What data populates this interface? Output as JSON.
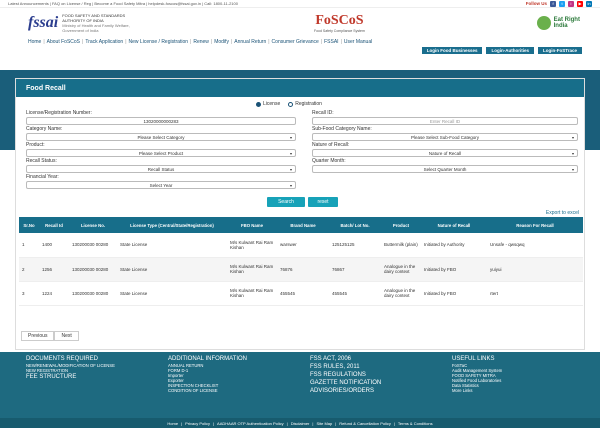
{
  "topbar": {
    "links": "Latest Announcements | FAQ on License / Reg | Become a Food Safety Mitra | helpdesk-foscos@fssai.gov.in | Call: 1800-11-2100",
    "follow_label": "Follow Us"
  },
  "header": {
    "fssai": "fssai",
    "authority": "FOOD SAFETY AND STANDARDS AUTHORITY OF INDIA",
    "ministry": "Ministry of Health and Family Welfare, Government of India",
    "app_name": "FoSCoS",
    "app_sub": "Food Safety Compliance System",
    "eatright1": "Eat Right",
    "eatright2": "India"
  },
  "nav": {
    "items": [
      "Home",
      "About FoSCoS",
      "Track Application",
      "New License / Registration",
      "Renew",
      "Modify",
      "Annual Return",
      "Consumer Grievance",
      "FSSAI",
      "User Manual"
    ],
    "sub": [
      "Login Food Businesses",
      "Login-Authorities",
      "Login-FoSTrace"
    ]
  },
  "form": {
    "title": "Food Recall",
    "radio_license": "License",
    "radio_registration": "Registration",
    "lic_label": "License/Registration Number:",
    "lic_value": "13020000000283",
    "recall_id_label": "Recall ID:",
    "recall_id_placeholder": "Enter Recall ID",
    "category_label": "Category Name:",
    "category_value": "Please Select Category",
    "subcategory_label": "Sub-Food Category Name:",
    "subcategory_value": "Please Select Sub-Food Category",
    "product_label": "Product:",
    "product_value": "Please Select Product",
    "nature_label": "Nature of Recall:",
    "nature_value": "Nature of Recall",
    "status_label": "Recall Status:",
    "status_value": "Recall Status",
    "quarter_label": "Quarter Month:",
    "quarter_value": "Select Quarter Month",
    "year_label": "Financial Year:",
    "year_value": "Select Year",
    "search_btn": "Search",
    "reset_btn": "reset",
    "export": "Export to excel"
  },
  "table": {
    "headers": [
      "Sr.No",
      "Recall Id",
      "License No.",
      "License Type (Central/State/Registration)",
      "FBO Name",
      "Brand Name",
      "Batch/ Lot No.",
      "Product",
      "Nature of Recall",
      "Reason For Recall"
    ],
    "rows": [
      [
        "1",
        "1400",
        "130200030 00280",
        "State License",
        "M/s Kulwant Rai Ram Kishan",
        "warswer",
        "125125125",
        "Buttermilk (plain)",
        "Initiated by Authority",
        "Unsafe - qwsqwq"
      ],
      [
        "2",
        "1256",
        "130200030 00280",
        "State License",
        "M/s Kulwant Rai Ram Kishan",
        "76876",
        "76867",
        "Analogue in the dairy context",
        "Initiated by FBO",
        "yuiyui"
      ],
      [
        "3",
        "1224",
        "130200030 00280",
        "State License",
        "M/s Kulwant Rai Ram Kishan",
        "455545",
        "455545",
        "Analogue in the dairy context",
        "Initiated by FBO",
        "rtert"
      ]
    ]
  },
  "pager": {
    "prev": "Previous",
    "next": "Next"
  },
  "footer": {
    "col1": {
      "h1": "DOCUMENTS REQUIRED",
      "a": "NEW/RENEWAL/MODIFICATION OF LICENSE",
      "b": "NEW REGISTRATION",
      "h2": "FEE STRUCTURE"
    },
    "col2": {
      "h": "ADDITIONAL INFORMATION",
      "items": [
        "ANNUAL RETURN",
        "FORM D-1",
        "Importer",
        "Exporter",
        "INSPECTION CHECKLIST",
        "CONDITION OF LICENSE"
      ]
    },
    "col3": {
      "items": [
        "FSS ACT, 2006",
        "FSS RULES, 2011",
        "FSS REGULATIONS",
        "GAZETTE NOTIFICATION",
        "ADVISORIES/ORDERS"
      ]
    },
    "col4": {
      "h": "USEFUL LINKS",
      "items": [
        "FoSTaC",
        "Audit Management System",
        "FOOD SAFETY MITRA",
        "Notified Food Laboratories",
        "Data Statistics",
        "More Links"
      ]
    },
    "bottom": [
      "Home",
      "Privacy Policy",
      "AADHAAR OTP Authentication Policy",
      "Disclaimer",
      "Site Map",
      "Refund & Cancellation Policy",
      "Terms & Conditions"
    ]
  }
}
